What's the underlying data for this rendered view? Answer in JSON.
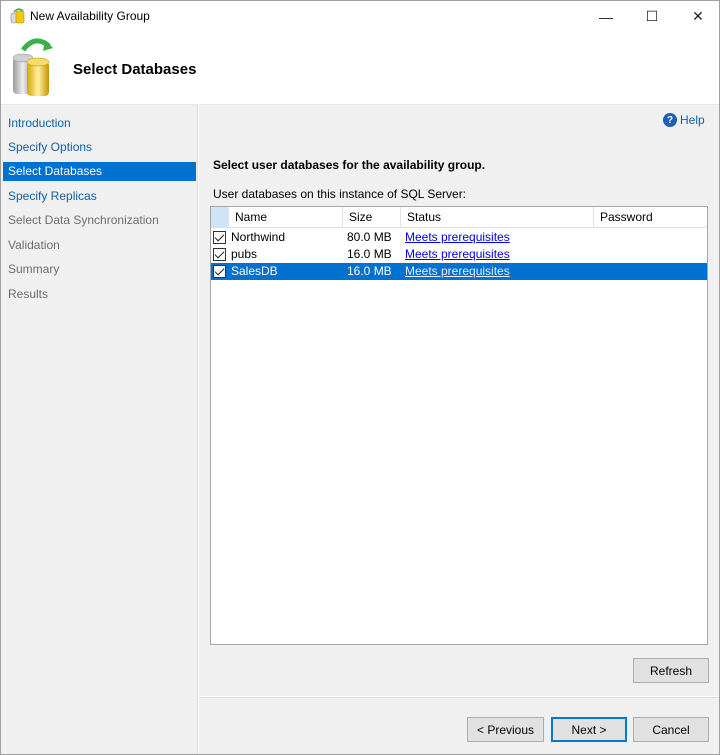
{
  "window": {
    "title": "New Availability Group",
    "minimize_glyph": "—",
    "maximize_glyph": "☐",
    "close_glyph": "✕"
  },
  "header": {
    "title": "Select Databases"
  },
  "nav": {
    "items": [
      {
        "label": "Introduction",
        "state": "link"
      },
      {
        "label": "Specify Options",
        "state": "link"
      },
      {
        "label": "Select Databases",
        "state": "active"
      },
      {
        "label": "Specify Replicas",
        "state": "link"
      },
      {
        "label": "Select Data Synchronization",
        "state": "disabled"
      },
      {
        "label": "Validation",
        "state": "disabled"
      },
      {
        "label": "Summary",
        "state": "disabled"
      },
      {
        "label": "Results",
        "state": "disabled"
      }
    ]
  },
  "content": {
    "help_label": "Help",
    "help_glyph": "?",
    "instruction": "Select user databases for the availability group.",
    "list_caption": "User databases on this instance of SQL Server:",
    "columns": {
      "name": "Name",
      "size": "Size",
      "status": "Status",
      "password": "Password"
    },
    "rows": [
      {
        "checked": true,
        "name": "Northwind",
        "size": "80.0 MB",
        "status": "Meets prerequisites",
        "password": "",
        "selected": false
      },
      {
        "checked": true,
        "name": "pubs",
        "size": "16.0 MB",
        "status": "Meets prerequisites",
        "password": "",
        "selected": false
      },
      {
        "checked": true,
        "name": "SalesDB",
        "size": "16.0 MB",
        "status": "Meets prerequisites",
        "password": "",
        "selected": true
      }
    ],
    "refresh_label": "Refresh"
  },
  "footer": {
    "previous_label": "< Previous",
    "next_label": "Next >",
    "cancel_label": "Cancel"
  },
  "colors": {
    "selection": "#0070d1",
    "link": "#1060a8",
    "panel": "#f0f0f0"
  }
}
